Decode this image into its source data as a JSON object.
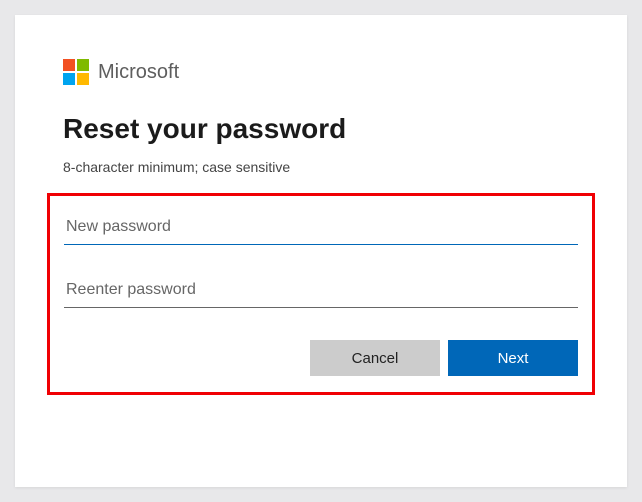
{
  "brand": {
    "name": "Microsoft"
  },
  "title": "Reset your password",
  "hint": "8-character minimum; case sensitive",
  "fields": {
    "new_password": {
      "placeholder": "New password",
      "value": ""
    },
    "reenter_password": {
      "placeholder": "Reenter password",
      "value": ""
    }
  },
  "buttons": {
    "cancel": "Cancel",
    "next": "Next"
  }
}
